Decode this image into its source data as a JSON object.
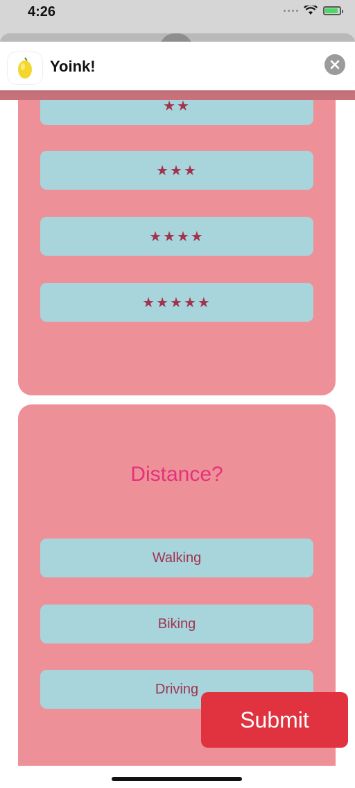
{
  "status_bar": {
    "time": "4:26"
  },
  "header": {
    "title": "Yoink!",
    "app_icon": "lemon-icon",
    "close_icon": "close-icon"
  },
  "rating_card": {
    "options": [
      {
        "label": "★★"
      },
      {
        "label": "★★★"
      },
      {
        "label": "★★★★"
      },
      {
        "label": "★★★★★"
      }
    ]
  },
  "distance_card": {
    "title": "Distance?",
    "options": [
      {
        "label": "Walking"
      },
      {
        "label": "Biking"
      },
      {
        "label": "Driving"
      }
    ]
  },
  "submit": {
    "label": "Submit"
  },
  "colors": {
    "card_bg": "#ee9097",
    "option_bg": "#a8d4dc",
    "option_text": "#a1334d",
    "title_text": "#e4327c",
    "submit_bg": "#e0323f"
  }
}
